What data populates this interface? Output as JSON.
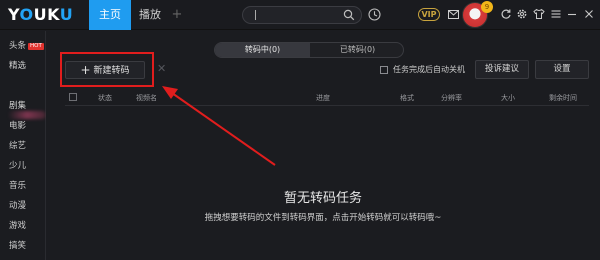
{
  "app": {
    "logo_text": "YOUKU",
    "tabs": [
      {
        "label": "主页"
      },
      {
        "label": "播放"
      }
    ],
    "add_tab": "+",
    "vip": "VIP",
    "avatar_badge": "9",
    "accent_color": "#1f9cf0",
    "highlight_color": "#e11d1d"
  },
  "sidebar": {
    "hot_badge": "HOT",
    "items": [
      {
        "label": "头条"
      },
      {
        "label": "精选"
      },
      {
        "label": "剧集"
      },
      {
        "label": "电影"
      },
      {
        "label": "综艺"
      },
      {
        "label": "少儿"
      },
      {
        "label": "音乐"
      },
      {
        "label": "动漫"
      },
      {
        "label": "游戏"
      },
      {
        "label": "搞笑"
      }
    ]
  },
  "transcode": {
    "tabs": [
      {
        "label": "转码中(0)"
      },
      {
        "label": "已转码(0)"
      }
    ],
    "new_button": "新建转码",
    "close": "✕",
    "auto_shutdown": "任务完成后自动关机",
    "feedback_button": "投诉建议",
    "settings_button": "设置",
    "columns": [
      "状态",
      "视频名",
      "进度",
      "格式",
      "分辨率",
      "大小",
      "剩余时间"
    ],
    "empty_title": "暂无转码任务",
    "empty_hint": "拖拽想要转码的文件到转码界面，点击开始转码就可以转码哦~"
  }
}
